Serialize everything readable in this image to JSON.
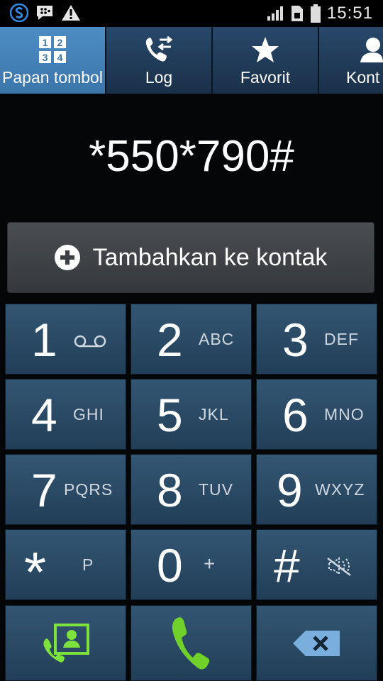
{
  "status_bar": {
    "time": "15:51",
    "icons": [
      "s-app-icon",
      "bbm-chat-icon",
      "warning-icon",
      "signal-icon",
      "sim-icon",
      "battery-icon"
    ]
  },
  "tabs": [
    {
      "label": "Papan tombol",
      "icon": "keypad-icon",
      "active": true
    },
    {
      "label": "Log",
      "icon": "call-log-icon",
      "active": false
    },
    {
      "label": "Favorit",
      "icon": "star-icon",
      "active": false
    },
    {
      "label": "Kont",
      "icon": "contacts-icon",
      "active": false
    }
  ],
  "dialed_number": "*550*790#",
  "add_contact": {
    "label": "Tambahkan ke kontak",
    "icon": "plus-circle-icon"
  },
  "keys": [
    {
      "digit": "1",
      "letters": "",
      "sub_icon": "voicemail-icon"
    },
    {
      "digit": "2",
      "letters": "ABC"
    },
    {
      "digit": "3",
      "letters": "DEF"
    },
    {
      "digit": "4",
      "letters": "GHI"
    },
    {
      "digit": "5",
      "letters": "JKL"
    },
    {
      "digit": "6",
      "letters": "MNO"
    },
    {
      "digit": "7",
      "letters": "PQRS"
    },
    {
      "digit": "8",
      "letters": "TUV"
    },
    {
      "digit": "9",
      "letters": "WXYZ"
    },
    {
      "digit": "*",
      "letters": "P"
    },
    {
      "digit": "0",
      "letters": "+"
    },
    {
      "digit": "#",
      "letters": "",
      "sub_icon": "mute-icon"
    }
  ],
  "bottom_actions": [
    {
      "icon": "contacts-call-icon"
    },
    {
      "icon": "call-icon"
    },
    {
      "icon": "backspace-icon"
    }
  ],
  "colors": {
    "tab_active": "#3a75aa",
    "tab_inactive": "#1f3a55",
    "key_bg": "#2a4a66",
    "call_green": "#6fd12a"
  }
}
